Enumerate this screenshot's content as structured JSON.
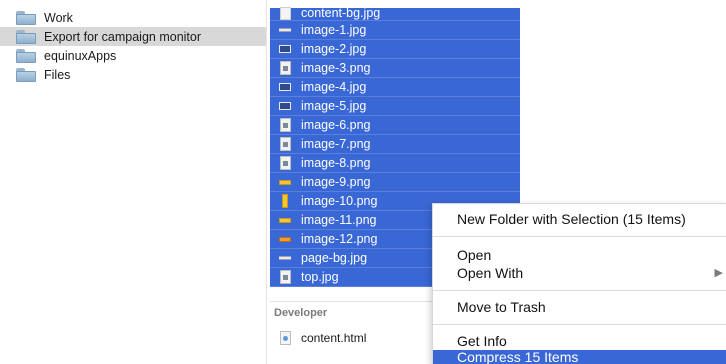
{
  "sidebar": {
    "folders": [
      {
        "label": "Work",
        "selected": false
      },
      {
        "label": "Export for campaign monitor",
        "selected": true
      },
      {
        "label": "equinuxApps",
        "selected": false
      },
      {
        "label": "Files",
        "selected": false
      }
    ]
  },
  "files": {
    "items": [
      {
        "name": "content-bg.jpg",
        "icon": "white-image-icon"
      },
      {
        "name": "image-1.jpg",
        "icon": "thin-line-image-icon"
      },
      {
        "name": "image-2.jpg",
        "icon": "blue-image-icon"
      },
      {
        "name": "image-3.png",
        "icon": "document-image-icon"
      },
      {
        "name": "image-4.jpg",
        "icon": "blue-image-icon"
      },
      {
        "name": "image-5.jpg",
        "icon": "blue-image-icon"
      },
      {
        "name": "image-6.png",
        "icon": "document-image-icon"
      },
      {
        "name": "image-7.png",
        "icon": "document-image-icon"
      },
      {
        "name": "image-8.png",
        "icon": "document-image-icon"
      },
      {
        "name": "image-9.png",
        "icon": "yellow-bar-image-icon"
      },
      {
        "name": "image-10.png",
        "icon": "yellow-vertical-image-icon"
      },
      {
        "name": "image-11.png",
        "icon": "yellow-bar-image-icon"
      },
      {
        "name": "image-12.png",
        "icon": "orange-bar-image-icon"
      },
      {
        "name": "page-bg.jpg",
        "icon": "thin-line-image-icon"
      },
      {
        "name": "top.jpg",
        "icon": "document-image-icon"
      }
    ],
    "selection_color": "#3a67d6"
  },
  "developer": {
    "header": "Developer",
    "item": {
      "name": "content.html",
      "icon": "html-file-icon"
    }
  },
  "context_menu": {
    "items": [
      {
        "label": "New Folder with Selection (15 Items)",
        "has_submenu": false
      },
      {
        "label": "Open",
        "has_submenu": false
      },
      {
        "label": "Open With",
        "has_submenu": true
      },
      {
        "label": "Move to Trash",
        "has_submenu": false
      },
      {
        "label": "Get Info",
        "has_submenu": false
      },
      {
        "label": "Compress 15 Items",
        "has_submenu": false,
        "highlighted": true
      }
    ],
    "submenu_arrow": "▶"
  }
}
